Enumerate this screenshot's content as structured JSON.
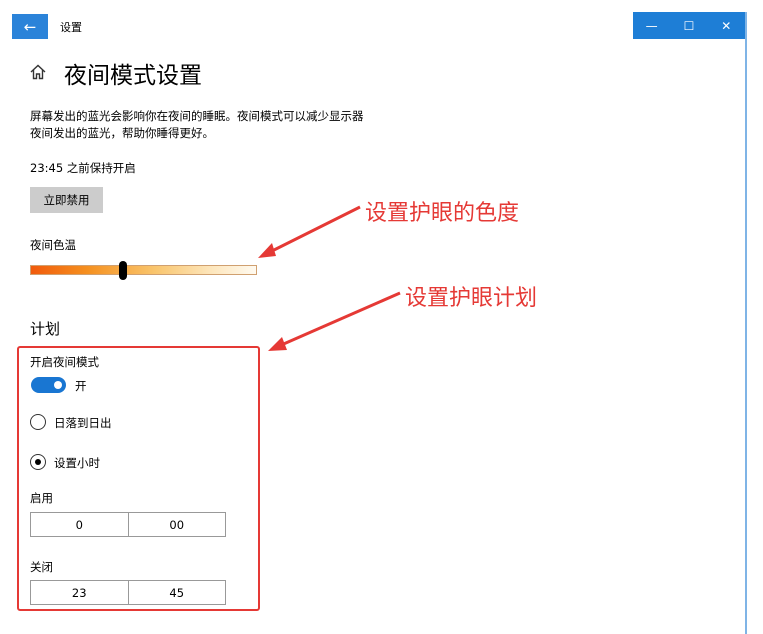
{
  "window": {
    "app_title": "设置",
    "back_glyph": "←",
    "controls": {
      "minimize": "—",
      "maximize": "☐",
      "close": "✕"
    }
  },
  "header": {
    "title": "夜间模式设置"
  },
  "description": {
    "line1": "屏幕发出的蓝光会影响你在夜间的睡眠。夜间模式可以减少显示器",
    "line2": "夜间发出的蓝光，帮助你睡得更好。"
  },
  "status": {
    "keep_on_text": "23:45 之前保持开启"
  },
  "disable_button": {
    "label": "立即禁用"
  },
  "color_temp": {
    "label": "夜间色温",
    "value": 0.41,
    "gradient": [
      "#f15a0c",
      "#f5901f",
      "#f9c56d",
      "#fde6bc",
      "#fffaf0"
    ]
  },
  "schedule": {
    "section_title": "计划",
    "toggle_label": "开启夜间模式",
    "toggle_state": "开",
    "toggle_on": true,
    "options": [
      {
        "label": "日落到日出",
        "checked": false
      },
      {
        "label": "设置小时",
        "checked": true
      }
    ],
    "start": {
      "label": "启用",
      "hour": "0",
      "minute": "00"
    },
    "end": {
      "label": "关闭",
      "hour": "23",
      "minute": "45"
    }
  },
  "annotations": {
    "color_note": "设置护眼的色度",
    "schedule_note": "设置护眼计划",
    "color": "#e53935"
  },
  "colors": {
    "accent": "#1976d2",
    "titlebar": "#1e7ed6",
    "back_button": "#2b83d9"
  }
}
